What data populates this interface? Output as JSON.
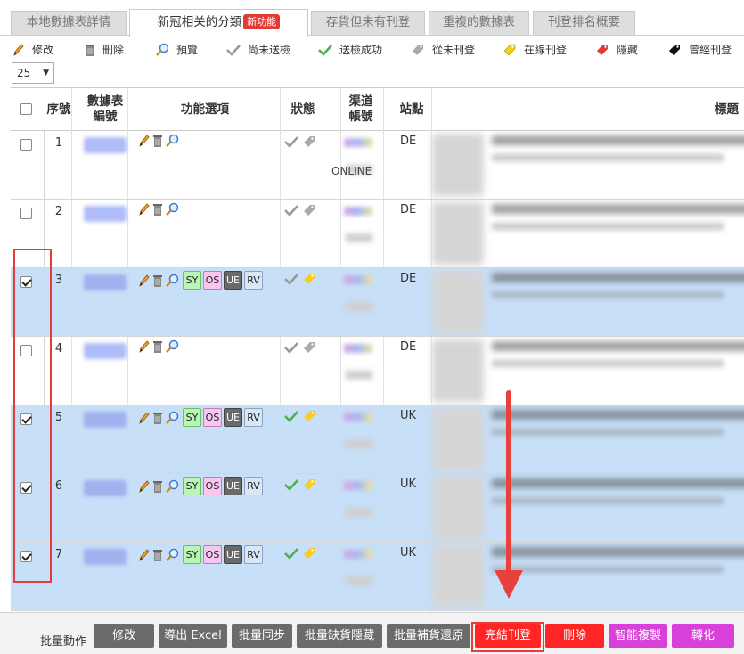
{
  "tabs": [
    {
      "label": "本地數據表詳情",
      "active": false
    },
    {
      "label": "新冠相关的分類",
      "active": true,
      "badge": "新功能"
    },
    {
      "label": "存貨但未有刊登",
      "active": false
    },
    {
      "label": "重複的數據表",
      "active": false
    },
    {
      "label": "刊登排名概要",
      "active": false
    }
  ],
  "legend": [
    {
      "icon": "pencil-icon",
      "label": "修改"
    },
    {
      "icon": "trash-icon",
      "label": "刪除"
    },
    {
      "icon": "magnifier-icon",
      "label": "預覽"
    },
    {
      "icon": "gray-check-icon",
      "label": "尚未送檢"
    },
    {
      "icon": "green-check-icon",
      "label": "送檢成功"
    },
    {
      "icon": "gray-tag-icon",
      "label": "從未刊登"
    },
    {
      "icon": "yellow-tag-icon",
      "label": "在線刊登"
    },
    {
      "icon": "red-tag-icon",
      "label": "隱藏"
    },
    {
      "icon": "black-tag-icon",
      "label": "曾經刊登"
    }
  ],
  "page_size": "25",
  "columns": {
    "seq": "序號",
    "sheet_id": "數據表編號",
    "functions": "功能選項",
    "status": "狀態",
    "channel": "渠道帳號",
    "site": "站點",
    "title": "標題"
  },
  "rows": [
    {
      "seq": "1",
      "checked": false,
      "site": "DE",
      "check": "gray",
      "tag": "gray",
      "chips": false,
      "channel_text": "ONLINE"
    },
    {
      "seq": "2",
      "checked": false,
      "site": "DE",
      "check": "gray",
      "tag": "gray",
      "chips": false,
      "channel_text": ""
    },
    {
      "seq": "3",
      "checked": true,
      "site": "DE",
      "check": "gray",
      "tag": "yellow",
      "chips": true,
      "channel_text": ""
    },
    {
      "seq": "4",
      "checked": false,
      "site": "DE",
      "check": "gray",
      "tag": "gray",
      "chips": false,
      "channel_text": ""
    },
    {
      "seq": "5",
      "checked": true,
      "site": "UK",
      "check": "green",
      "tag": "yellow",
      "chips": true,
      "channel_text": ""
    },
    {
      "seq": "6",
      "checked": true,
      "site": "UK",
      "check": "green",
      "tag": "yellow",
      "chips": true,
      "channel_text": ""
    },
    {
      "seq": "7",
      "checked": true,
      "site": "UK",
      "check": "green",
      "tag": "yellow",
      "chips": true,
      "channel_text": ""
    }
  ],
  "chips": [
    "SY",
    "OS",
    "UE",
    "RV"
  ],
  "batch": {
    "label": "批量動作",
    "buttons": [
      {
        "label": "修改",
        "color": "gray"
      },
      {
        "label": "導出 Excel",
        "color": "gray"
      },
      {
        "label": "批量同步",
        "color": "gray"
      },
      {
        "label": "批量缺貨隱藏",
        "color": "gray"
      },
      {
        "label": "批量補貨還原",
        "color": "gray"
      },
      {
        "label": "完結刊登",
        "color": "red"
      },
      {
        "label": "刪除",
        "color": "red"
      },
      {
        "label": "智能複製",
        "color": "magenta"
      },
      {
        "label": "轉化",
        "color": "magenta"
      }
    ]
  }
}
